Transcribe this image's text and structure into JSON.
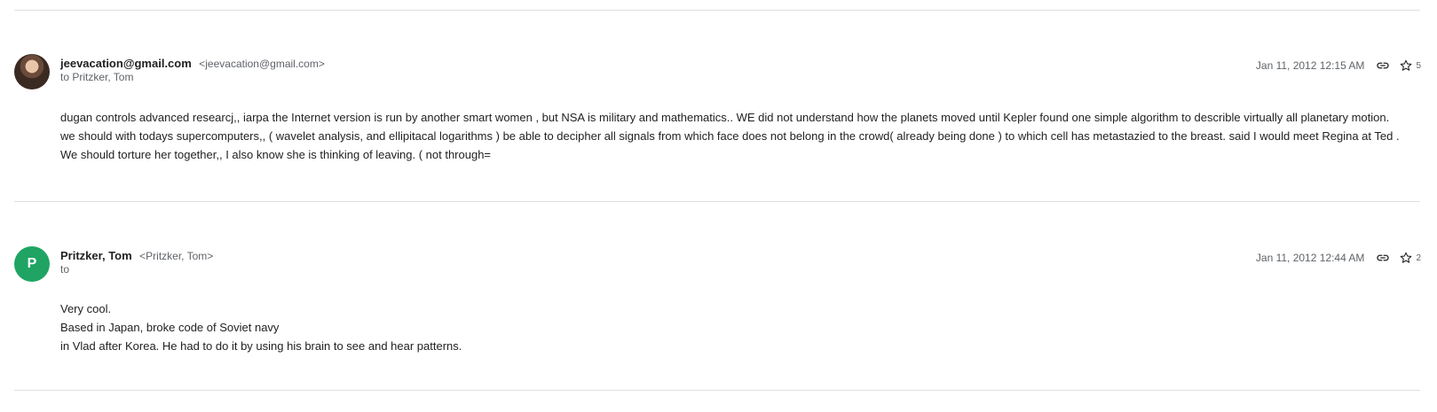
{
  "messages": [
    {
      "sender_name": "jeevacation@gmail.com",
      "sender_email": "<jeevacation@gmail.com>",
      "recipients": "to Pritzker, Tom",
      "date": "Jan 11, 2012 12:15 AM",
      "star_count": "5",
      "avatar_letter": "",
      "body_lines": [
        "dugan controls advanced researcj,, iarpa the Internet version is run by another smart women , but NSA is military and mathematics.. WE did not understand how the planets moved until Kepler found one simple algorithm to describle virtually all planetary motion. we should with todays supercomputers,, ( wavelet analysis, and ellipitacal logarithms ) be able to decipher all signals from which face does not belong in the crowd( already being done ) to which cell has metastazied to the breast. said I would meet Regina at Ted . We should torture her together,, I also know she is thinking of leaving. ( not through="
      ]
    },
    {
      "sender_name": "Pritzker, Tom",
      "sender_email": "<Pritzker, Tom>",
      "recipients": "to",
      "date": "Jan 11, 2012 12:44 AM",
      "star_count": "2",
      "avatar_letter": "P",
      "body_lines": [
        "Very cool.",
        "Based in Japan, broke code of Soviet navy",
        "in Vlad after Korea. He had to do it by using his brain to see and hear patterns."
      ]
    }
  ],
  "icons": {
    "link": "link-icon",
    "star": "star-icon",
    "avatar_photo": "avatar-photo"
  },
  "colors": {
    "avatar_green": "#1fa463",
    "divider": "#e0e0e0",
    "secondary_text": "#5f6368"
  }
}
